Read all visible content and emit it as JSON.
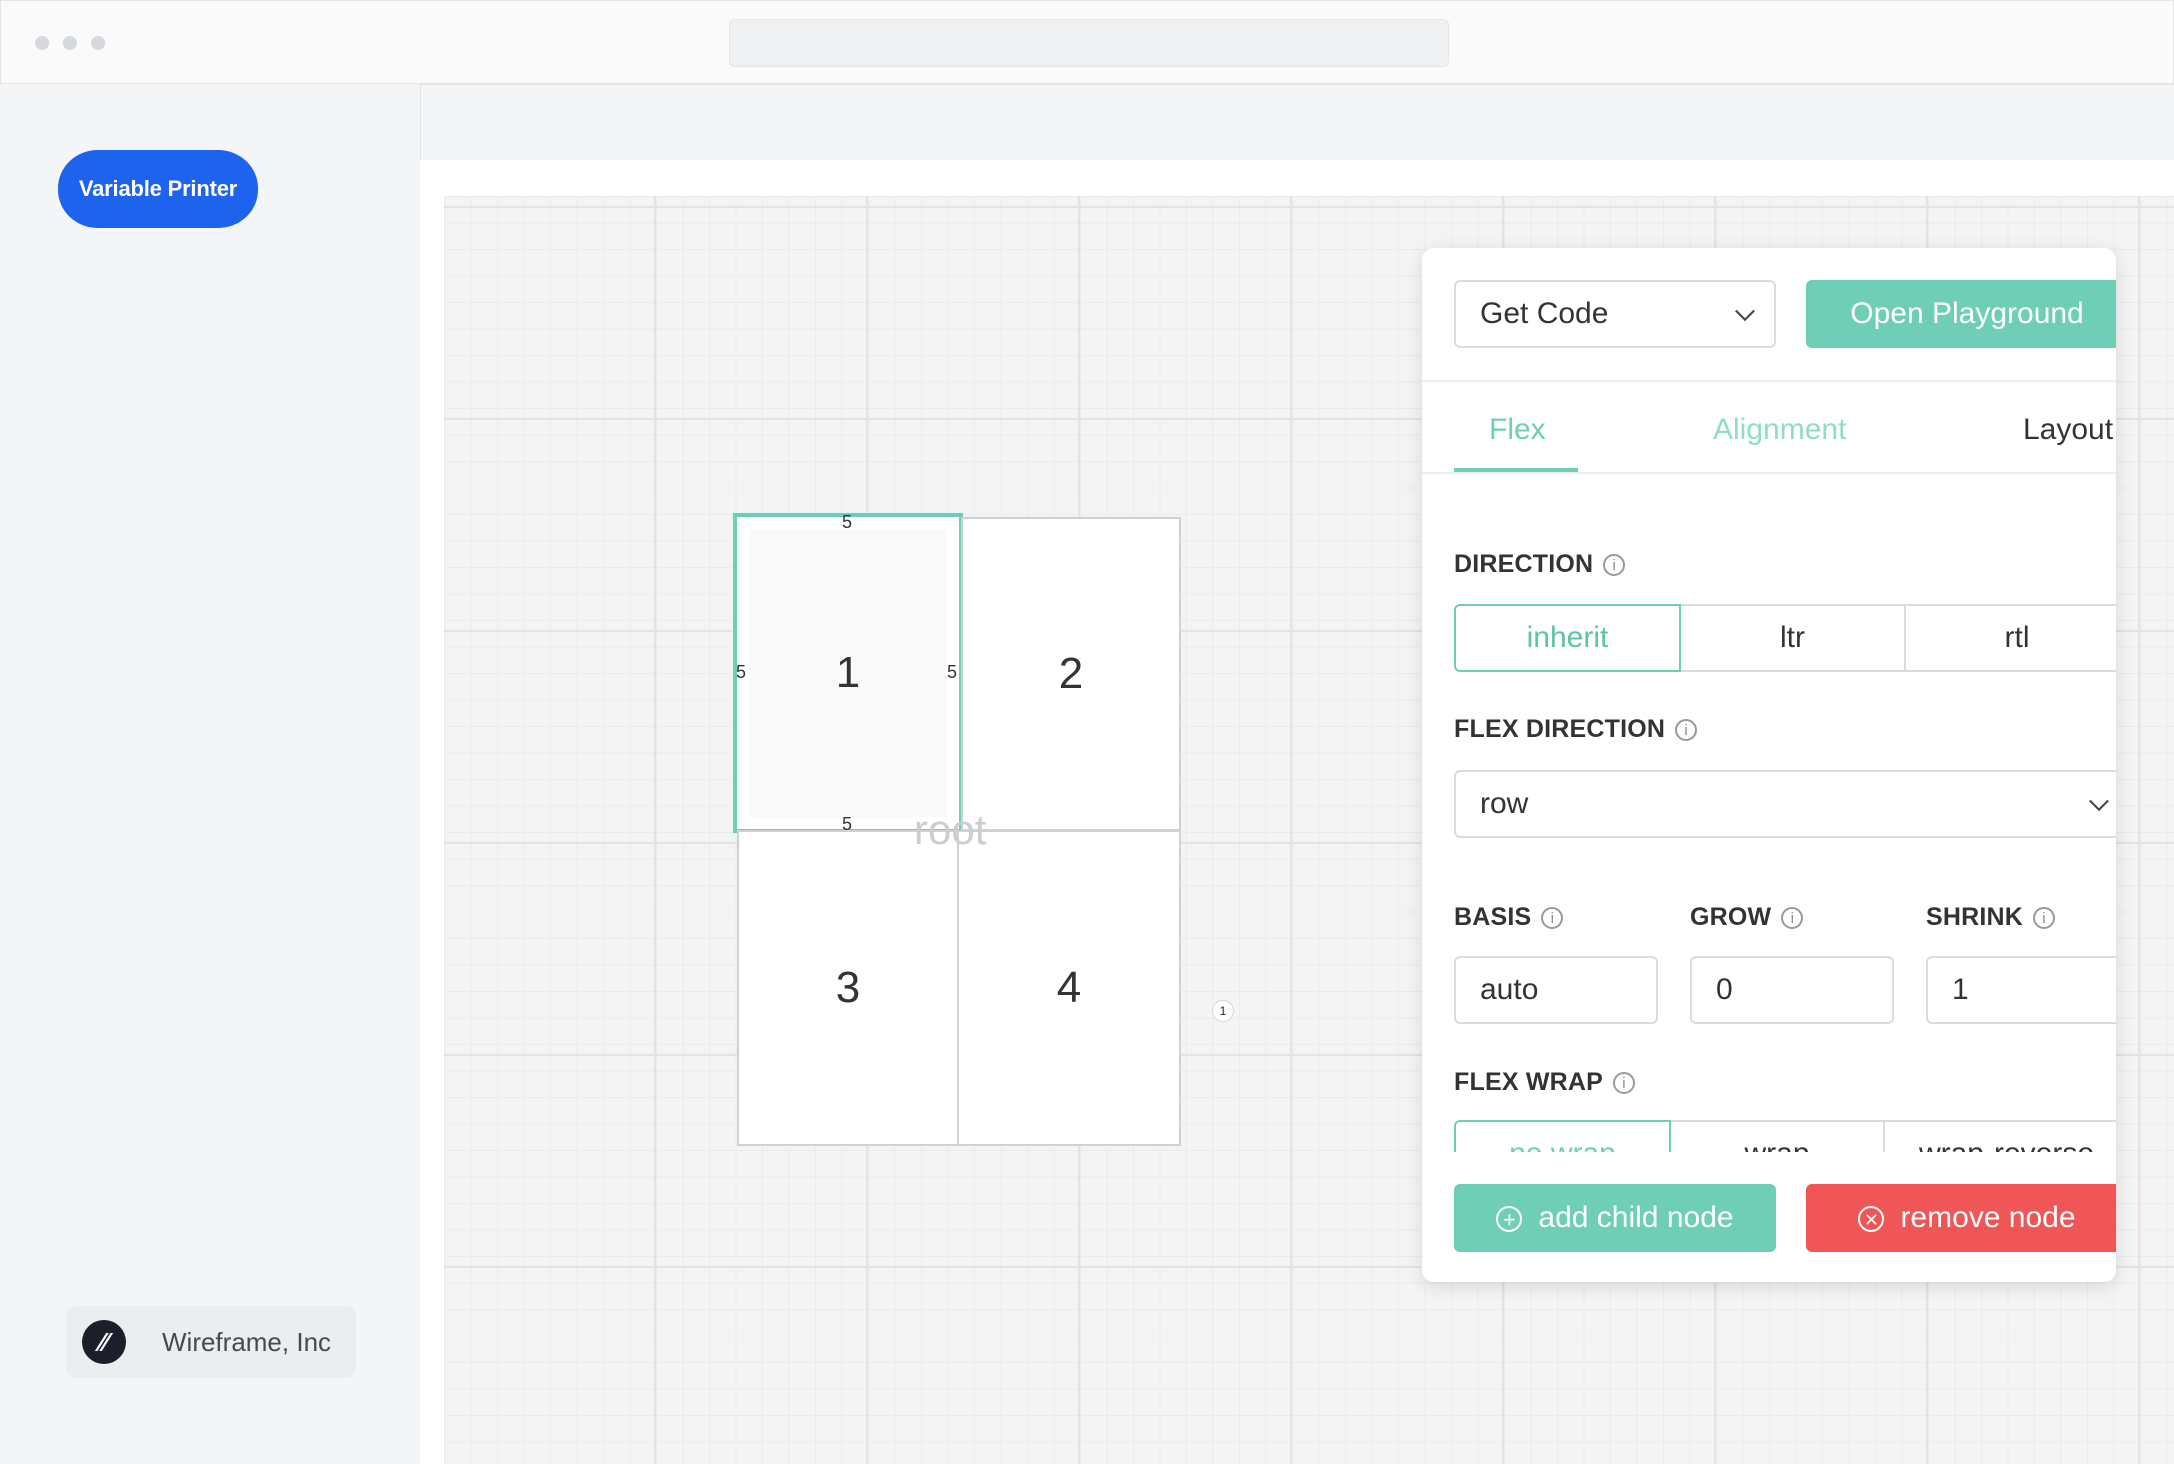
{
  "app": {
    "logo_text": "Variable Printer",
    "brand": {
      "name": "Wireframe, Inc",
      "icon": "slash-logo-icon"
    }
  },
  "canvas": {
    "nodes": [
      "1",
      "2",
      "3",
      "4"
    ],
    "selected_paddings": {
      "top": "5",
      "left": "5",
      "right": "5",
      "bottom": "5"
    },
    "root_label": "root",
    "badge": "1"
  },
  "panel": {
    "get_code": "Get Code",
    "open_playground": "Open Playground",
    "tabs": {
      "flex": "Flex",
      "alignment": "Alignment",
      "layout": "Layout"
    },
    "direction": {
      "label": "DIRECTION",
      "options": [
        "inherit",
        "ltr",
        "rtl"
      ],
      "selected": "inherit"
    },
    "flex_direction": {
      "label": "FLEX DIRECTION",
      "value": "row"
    },
    "basis": {
      "label": "BASIS",
      "value": "auto"
    },
    "grow": {
      "label": "GROW",
      "value": "0"
    },
    "shrink": {
      "label": "SHRINK",
      "value": "1"
    },
    "flex_wrap": {
      "label": "FLEX WRAP",
      "options": [
        "no wrap",
        "wrap",
        "wrap-reverse"
      ],
      "selected": "no wrap"
    },
    "add_child": "add child node",
    "remove_node": "remove node"
  },
  "colors": {
    "accent": "#6fcfb6",
    "danger": "#f15656",
    "logo_blue": "#1d63ed"
  }
}
